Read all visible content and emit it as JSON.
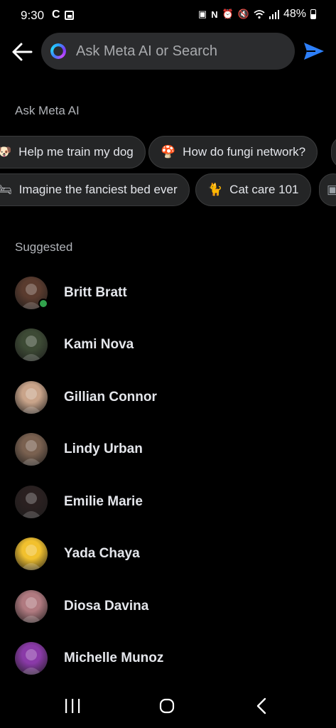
{
  "status_bar": {
    "time": "9:30",
    "battery": "48%",
    "icons": [
      "c-icon",
      "gallery-icon",
      "lock-icon",
      "nfc-icon",
      "alarm-icon",
      "mute-icon",
      "wifi-icon",
      "signal-icon",
      "battery-icon"
    ]
  },
  "search": {
    "placeholder": "Ask Meta AI or Search"
  },
  "ask_meta_ai": {
    "title": "Ask Meta AI",
    "row1": [
      {
        "emoji": "🐶",
        "label": "Help me train my dog"
      },
      {
        "emoji": "🍄",
        "label": "How do fungi network?"
      }
    ],
    "row2": [
      {
        "emoji": "🛏",
        "label": "Imagine the fanciest bed ever"
      },
      {
        "emoji": "🐈",
        "label": "Cat care 101"
      }
    ]
  },
  "suggested": {
    "title": "Suggested",
    "contacts": [
      {
        "name": "Britt Bratt",
        "online": true,
        "avatar_color": "#5a3b2e"
      },
      {
        "name": "Kami Nova",
        "online": false,
        "avatar_color": "#3d4a35"
      },
      {
        "name": "Gillian Connor",
        "online": false,
        "avatar_color": "#c9a48a"
      },
      {
        "name": "Lindy Urban",
        "online": false,
        "avatar_color": "#7a6150"
      },
      {
        "name": "Emilie Marie",
        "online": false,
        "avatar_color": "#2a2020"
      },
      {
        "name": "Yada Chaya",
        "online": false,
        "avatar_color": "#f2c12e"
      },
      {
        "name": "Diosa Davina",
        "online": false,
        "avatar_color": "#b07a80"
      },
      {
        "name": "Michelle Munoz",
        "online": false,
        "avatar_color": "#8a3aa8"
      }
    ]
  },
  "colors": {
    "background": "#000000",
    "search_bg": "#2b2c2e",
    "chip_bg": "#242526",
    "accent_send": "#2d7ff9",
    "online": "#31a24c",
    "secondary_text": "#b0b3b8"
  }
}
